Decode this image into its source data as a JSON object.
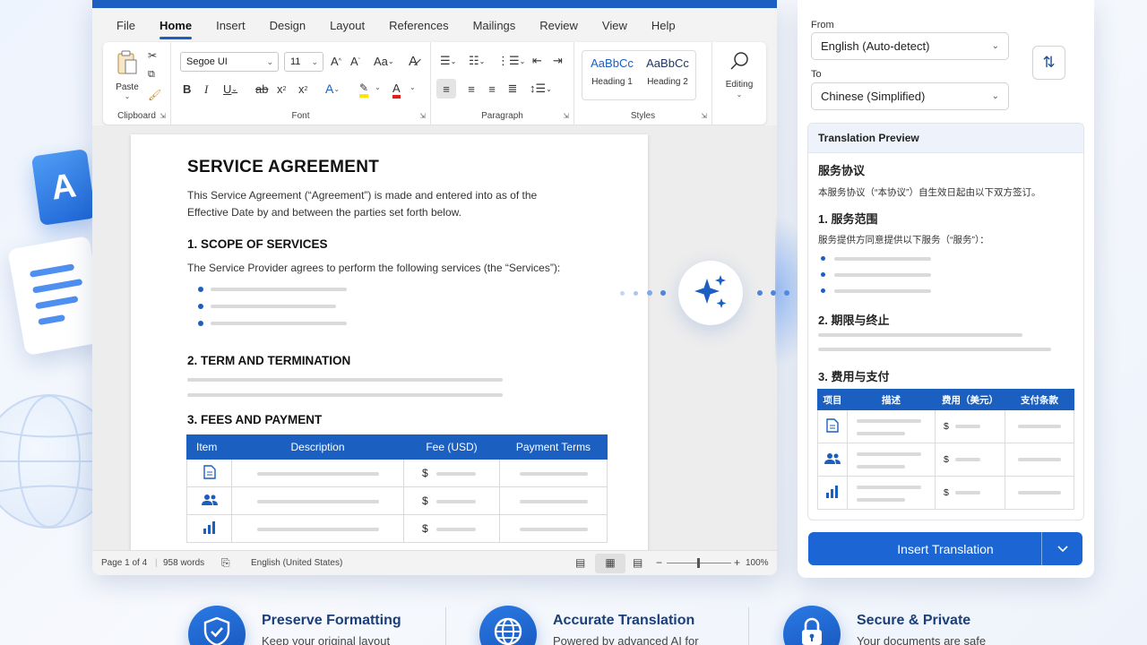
{
  "menu": {
    "tabs": [
      "File",
      "Home",
      "Insert",
      "Design",
      "Layout",
      "References",
      "Mailings",
      "Review",
      "View",
      "Help"
    ],
    "active": "Home"
  },
  "ribbon": {
    "paste_label": "Paste",
    "clipboard_label": "Clipboard",
    "font_name": "Segoe UI",
    "font_size": "11",
    "font_label": "Font",
    "paragraph_label": "Paragraph",
    "styles_label": "Styles",
    "style_preview": "AaBbCc",
    "heading1": "Heading 1",
    "heading2": "Heading 2",
    "editing_label": "Editing"
  },
  "document": {
    "title": "SERVICE AGREEMENT",
    "intro": "This Service Agreement (“Agreement”) is made and entered into as of the Effective Date by and between the parties set forth below.",
    "s1": "1.  SCOPE OF SERVICES",
    "s1_text": "The Service Provider agrees to perform the following services (the “Services”):",
    "s2": "2.  TERM AND TERMINATION",
    "s3": "3.  FEES AND PAYMENT",
    "table_headers": [
      "Item",
      "Description",
      "Fee (USD)",
      "Payment Terms"
    ],
    "currency": "$"
  },
  "status": {
    "page": "Page 1 of 4",
    "words": "958 words",
    "language": "English (United States)",
    "zoom": "100%"
  },
  "panel": {
    "from_label": "From",
    "from_value": "English (Auto-detect)",
    "to_label": "To",
    "to_value": "Chinese (Simplified)",
    "preview_title": "Translation Preview",
    "t_title": "服务协议",
    "t_intro": "本服务协议（“本协议”）自生效日起由以下双方签订。",
    "t_s1": "1.  服务范围",
    "t_s1_text": "服务提供方同意提供以下服务（“服务”）：",
    "t_s2": "2.  期限与终止",
    "t_s3": "3.  费用与支付",
    "t_table_headers": [
      "项目",
      "描述",
      "费用（美元）",
      "支付条款"
    ],
    "currency": "$",
    "insert_label": "Insert Translation"
  },
  "features": [
    {
      "title": "Preserve Formatting",
      "desc": "Keep your original layout",
      "icon": "shield-check-icon"
    },
    {
      "title": "Accurate Translation",
      "desc": "Powered by advanced AI for",
      "icon": "globe-icon"
    },
    {
      "title": "Secure & Private",
      "desc": "Your documents are safe",
      "icon": "lock-icon"
    }
  ],
  "colors": {
    "accent": "#1b5fc1",
    "button": "#1b66d4",
    "feature_title": "#1a3f7a"
  }
}
